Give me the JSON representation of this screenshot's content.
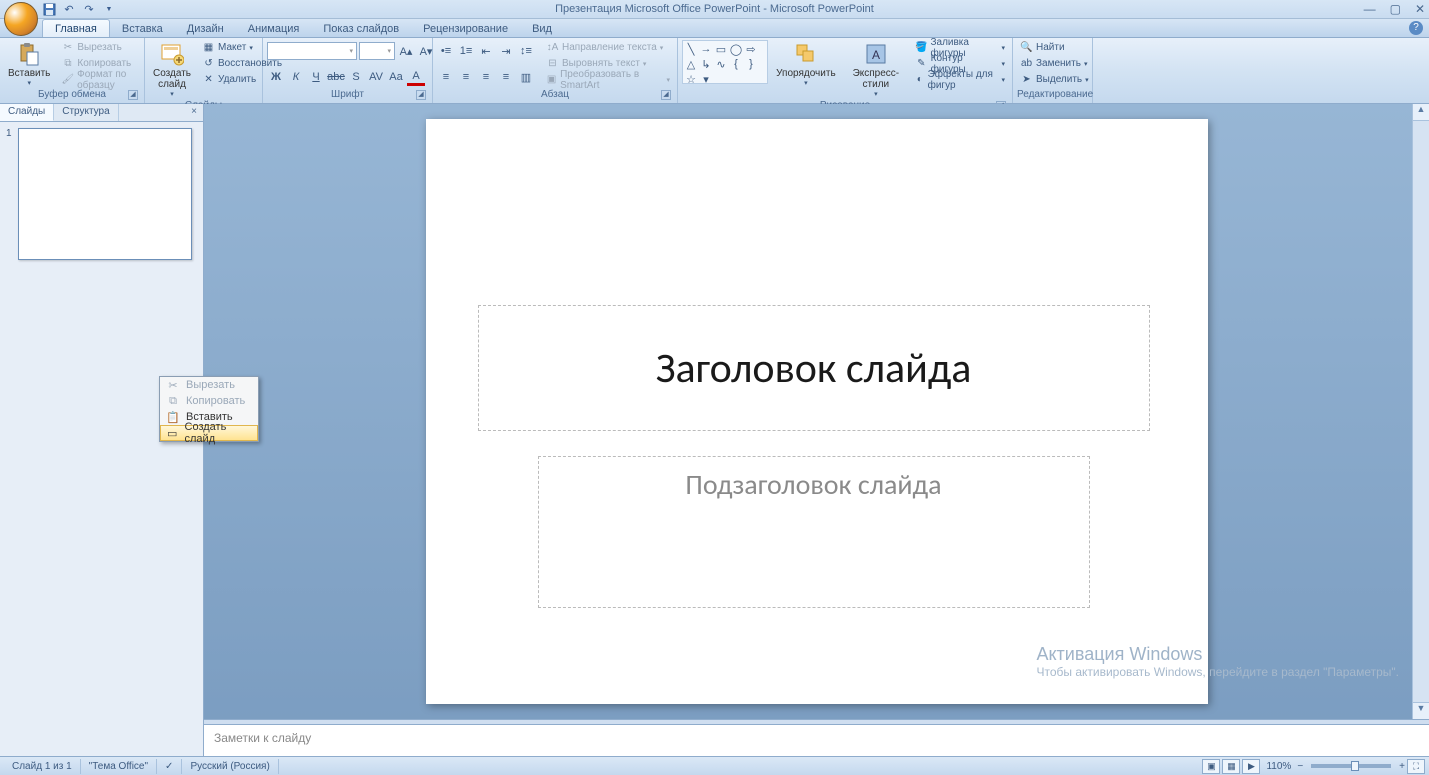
{
  "title": "Презентация Microsoft Office PowerPoint - Microsoft PowerPoint",
  "tabs": [
    "Главная",
    "Вставка",
    "Дизайн",
    "Анимация",
    "Показ слайдов",
    "Рецензирование",
    "Вид"
  ],
  "active_tab": 0,
  "ribbon": {
    "clipboard": {
      "label": "Буфер обмена",
      "paste": "Вставить",
      "cut": "Вырезать",
      "copy": "Копировать",
      "fmt": "Формат по образцу"
    },
    "slides": {
      "label": "Слайды",
      "new": "Создать\nслайд",
      "layout": "Макет",
      "reset": "Восстановить",
      "delete": "Удалить"
    },
    "font": {
      "label": "Шрифт"
    },
    "para": {
      "label": "Абзац",
      "textdir": "Направление текста",
      "align": "Выровнять текст",
      "smartart": "Преобразовать в SmartArt"
    },
    "draw": {
      "label": "Рисование",
      "arrange": "Упорядочить",
      "quick": "Экспресс-стили",
      "fill": "Заливка фигуры",
      "outline": "Контур фигуры",
      "effects": "Эффекты для фигур"
    },
    "edit": {
      "label": "Редактирование",
      "find": "Найти",
      "replace": "Заменить",
      "select": "Выделить"
    }
  },
  "leftpane": {
    "tabs": [
      "Слайды",
      "Структура"
    ],
    "active": 0,
    "slide_num": "1"
  },
  "context_menu": {
    "cut": "Вырезать",
    "copy": "Копировать",
    "paste": "Вставить",
    "new": "Создать слайд"
  },
  "slide": {
    "title_ph": "Заголовок слайда",
    "subtitle_ph": "Подзаголовок слайда"
  },
  "notes_ph": "Заметки к слайду",
  "watermark": {
    "line1": "Активация Windows",
    "line2": "Чтобы активировать Windows, перейдите в раздел \"Параметры\"."
  },
  "status": {
    "slide": "Слайд 1 из 1",
    "theme": "\"Тема Office\"",
    "lang": "Русский (Россия)",
    "zoom": "110%"
  }
}
